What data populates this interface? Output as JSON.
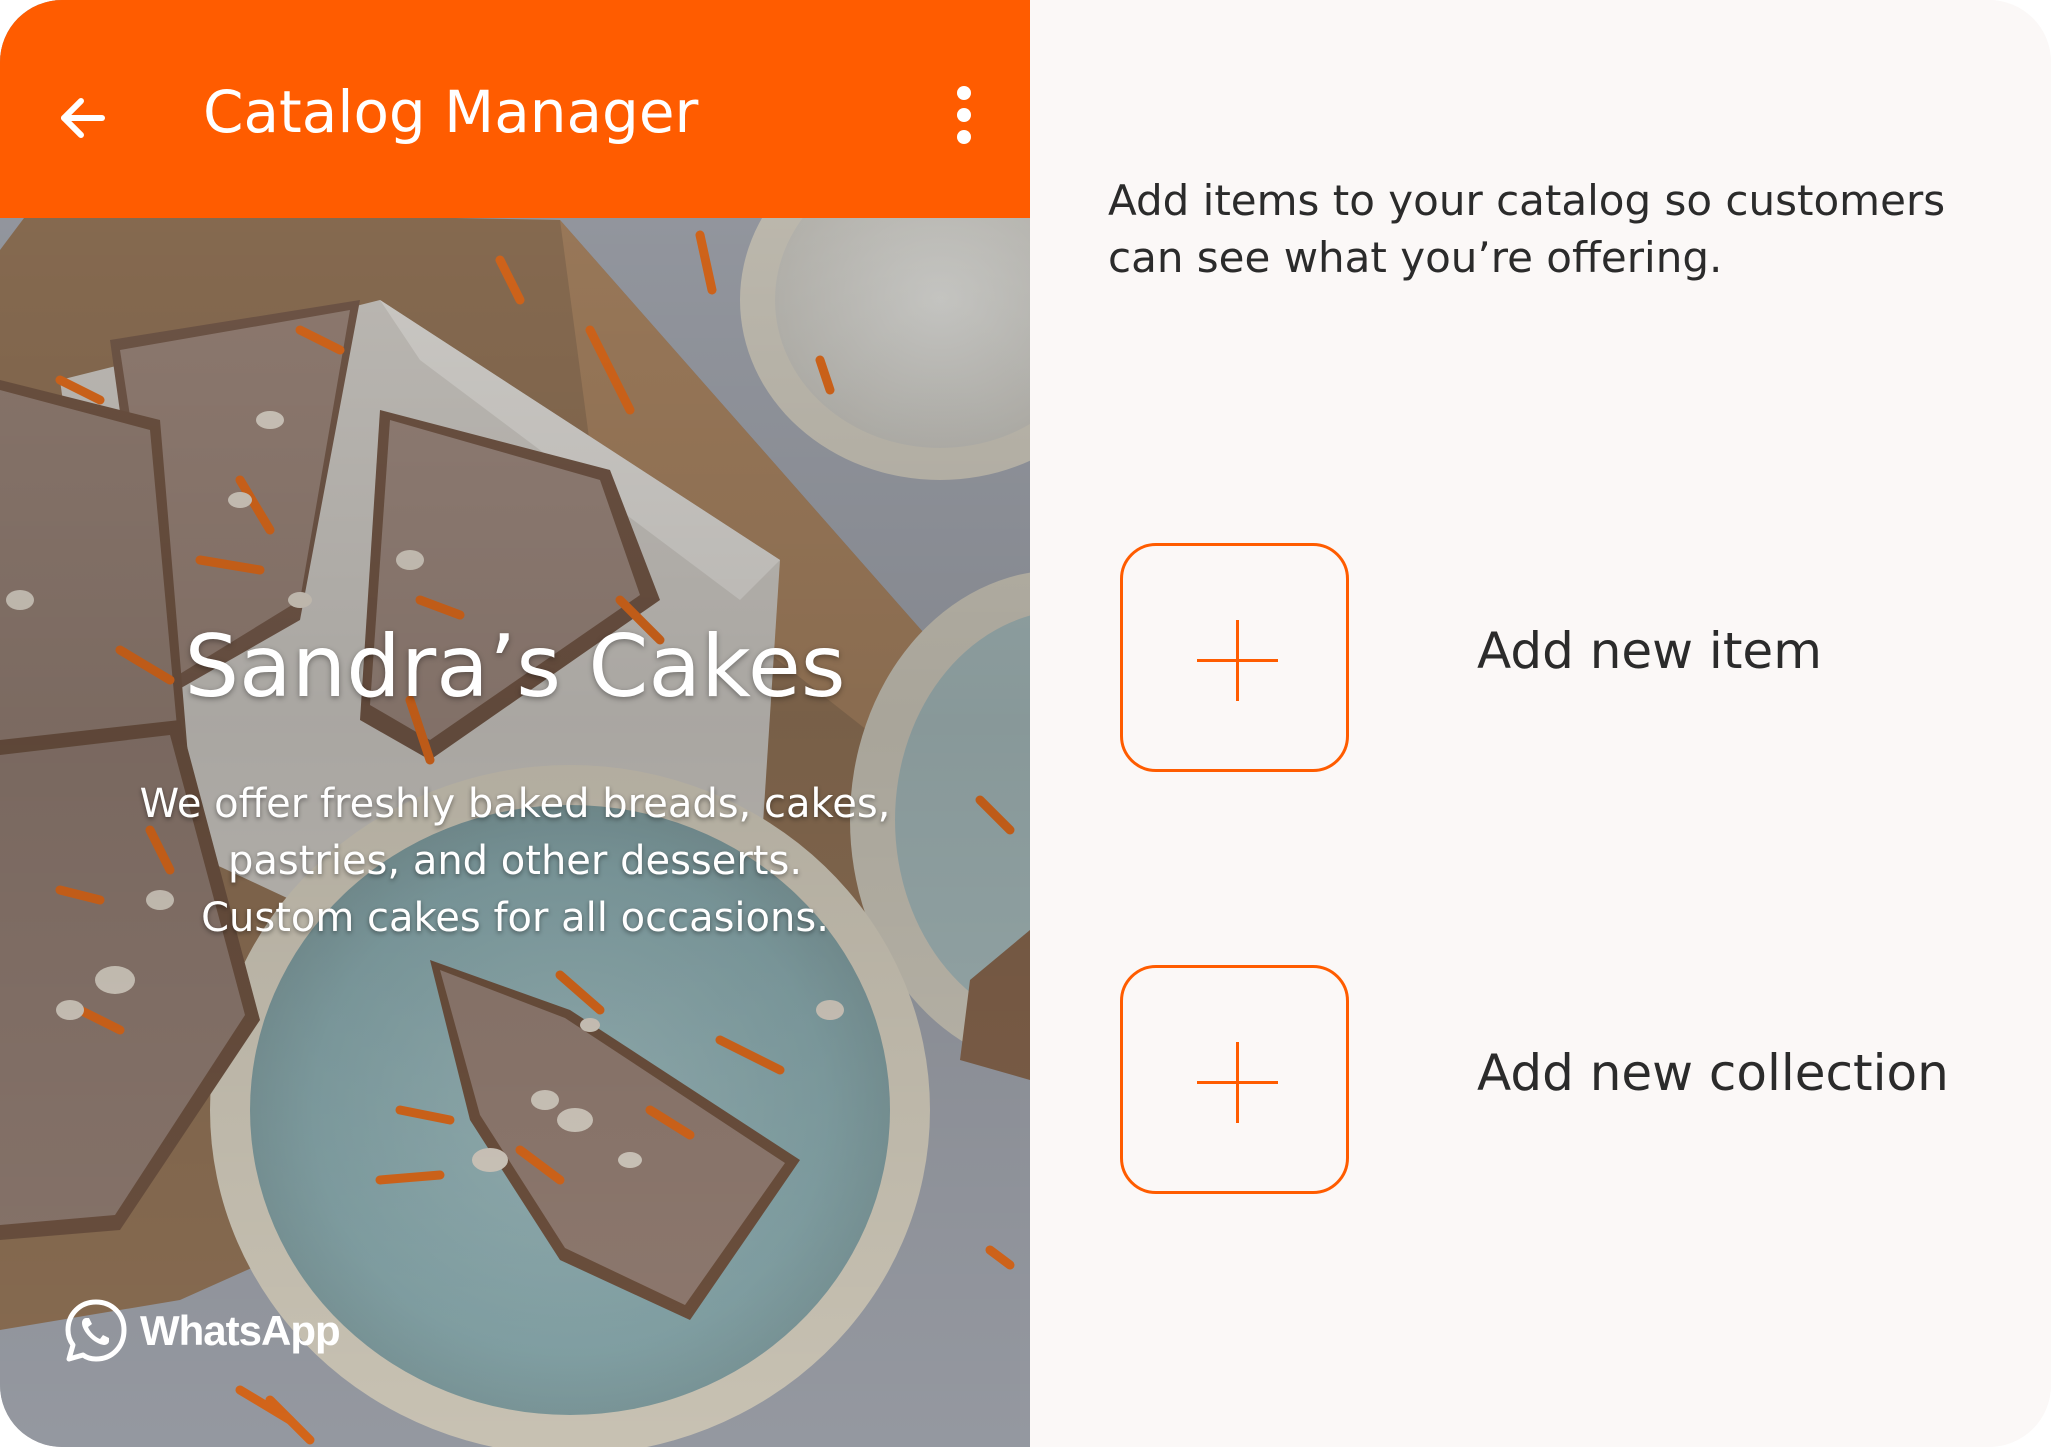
{
  "header": {
    "title": "Catalog Manager",
    "back_icon": "arrow-left-icon",
    "menu_icon": "more-vertical-icon",
    "accent_color": "#ff5c00"
  },
  "profile": {
    "shop_name": "Sandra’s Cakes",
    "description_lines": [
      "We offer freshly baked breads, cakes,",
      "pastries, and other desserts.",
      "Custom cakes for all occasions."
    ],
    "brand": "WhatsApp"
  },
  "main": {
    "intro_lines": [
      "Add items to your catalog so customers",
      "can see what you’re offering."
    ],
    "actions": [
      {
        "label": "Add new item",
        "icon": "plus-icon"
      },
      {
        "label": "Add new collection",
        "icon": "plus-icon"
      }
    ]
  }
}
